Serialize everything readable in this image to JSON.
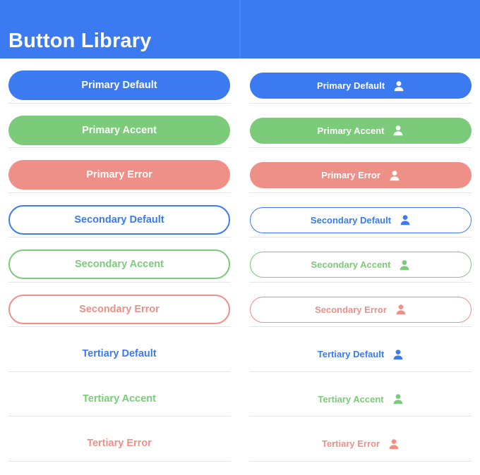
{
  "header": {
    "title": "Button Library",
    "background": "#3B7AF0"
  },
  "colors": {
    "default": "#3B7AF0",
    "accent": "#7BCB7B",
    "error": "#EE9088",
    "separator": "#E4E4E4"
  },
  "buttons": [
    {
      "label": "Primary Default",
      "style": "primary",
      "color": "default"
    },
    {
      "label": "Primary Accent",
      "style": "primary",
      "color": "accent"
    },
    {
      "label": "Primary Error",
      "style": "primary",
      "color": "error"
    },
    {
      "label": "Secondary Default",
      "style": "secondary",
      "color": "default"
    },
    {
      "label": "Secondary Accent",
      "style": "secondary",
      "color": "accent"
    },
    {
      "label": "Secondary Error",
      "style": "secondary",
      "color": "error"
    },
    {
      "label": "Tertiary Default",
      "style": "tertiary",
      "color": "default"
    },
    {
      "label": "Tertiary Accent",
      "style": "tertiary",
      "color": "accent"
    },
    {
      "label": "Tertiary Error",
      "style": "tertiary",
      "color": "error"
    }
  ],
  "icon_buttons": {
    "icon": "person-icon",
    "items": [
      {
        "label": "Primary Default",
        "style": "primary",
        "color": "default"
      },
      {
        "label": "Primary Accent",
        "style": "primary",
        "color": "accent"
      },
      {
        "label": "Primary Error",
        "style": "primary",
        "color": "error"
      },
      {
        "label": "Secondary Default",
        "style": "secondary",
        "color": "default"
      },
      {
        "label": "Secondary Accent",
        "style": "secondary",
        "color": "accent"
      },
      {
        "label": "Secondary Error",
        "style": "secondary",
        "color": "error"
      },
      {
        "label": "Tertiary Default",
        "style": "tertiary",
        "color": "default"
      },
      {
        "label": "Tertiary Accent",
        "style": "tertiary",
        "color": "accent"
      },
      {
        "label": "Tertiary Error",
        "style": "tertiary",
        "color": "error"
      }
    ]
  }
}
